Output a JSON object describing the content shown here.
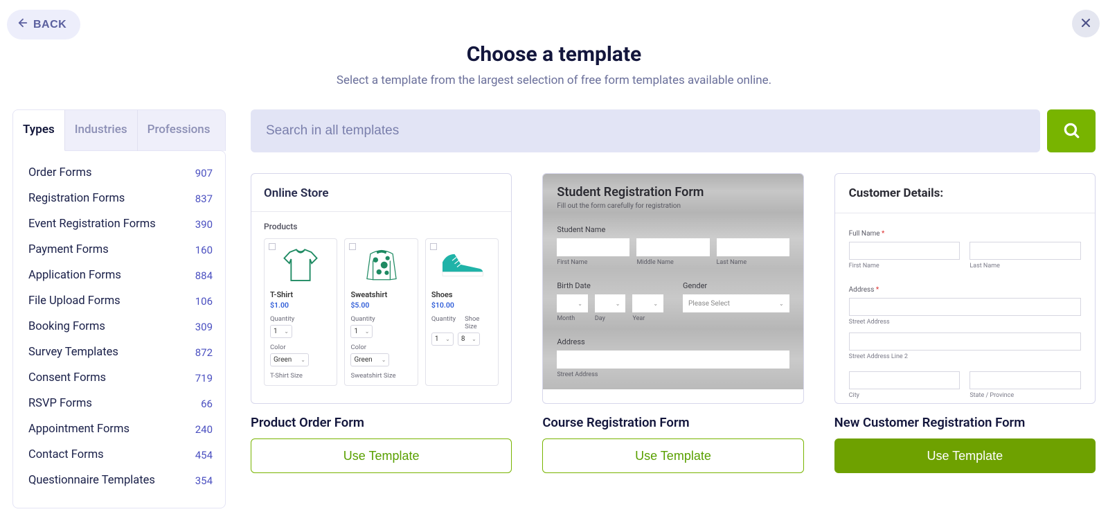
{
  "back_label": "BACK",
  "header": {
    "title": "Choose a template",
    "subtitle": "Select a template from the largest selection of free form templates available online."
  },
  "sidebar": {
    "tabs": [
      {
        "label": "Types",
        "active": true
      },
      {
        "label": "Industries",
        "active": false
      },
      {
        "label": "Professions",
        "active": false
      }
    ],
    "categories": [
      {
        "name": "Order Forms",
        "count": "907"
      },
      {
        "name": "Registration Forms",
        "count": "837"
      },
      {
        "name": "Event Registration Forms",
        "count": "390"
      },
      {
        "name": "Payment Forms",
        "count": "160"
      },
      {
        "name": "Application Forms",
        "count": "884"
      },
      {
        "name": "File Upload Forms",
        "count": "106"
      },
      {
        "name": "Booking Forms",
        "count": "309"
      },
      {
        "name": "Survey Templates",
        "count": "872"
      },
      {
        "name": "Consent Forms",
        "count": "719"
      },
      {
        "name": "RSVP Forms",
        "count": "66"
      },
      {
        "name": "Appointment Forms",
        "count": "240"
      },
      {
        "name": "Contact Forms",
        "count": "454"
      },
      {
        "name": "Questionnaire Templates",
        "count": "354"
      }
    ]
  },
  "search": {
    "placeholder": "Search in all templates"
  },
  "cards": [
    {
      "title": "Product Order Form",
      "button": "Use Template",
      "style": "outline",
      "preview": {
        "title": "Online Store",
        "label_products": "Products",
        "products": [
          {
            "name": "T-Shirt",
            "price": "$1.00",
            "qty_label": "Quantity",
            "qty": "1",
            "color_label": "Color",
            "color": "Green",
            "size_label": "T-Shirt Size"
          },
          {
            "name": "Sweatshirt",
            "price": "$5.00",
            "qty_label": "Quantity",
            "qty": "1",
            "color_label": "Color",
            "color": "Green",
            "size_label": "Sweatshirt Size"
          },
          {
            "name": "Shoes",
            "price": "$10.00",
            "qty_label": "Quantity",
            "qty": "1",
            "shoesize_label": "Shoe Size",
            "shoesize": "8"
          }
        ]
      }
    },
    {
      "title": "Course Registration Form",
      "button": "Use Template",
      "style": "outline",
      "preview": {
        "title": "Student Registration Form",
        "subtitle": "Fill out the form carefully for registration",
        "name_label": "Student Name",
        "name_caps": [
          "First Name",
          "Middle Name",
          "Last Name"
        ],
        "birth_label": "Birth Date",
        "birth_caps": [
          "Month",
          "Day",
          "Year"
        ],
        "gender_label": "Gender",
        "gender_placeholder": "Please Select",
        "address_label": "Address",
        "address_cap": "Street Address"
      }
    },
    {
      "title": "New Customer Registration Form",
      "button": "Use Template",
      "style": "solid",
      "preview": {
        "title": "Customer Details:",
        "fullname_label": "Full Name",
        "fullname_caps": [
          "First Name",
          "Last Name"
        ],
        "address_label": "Address",
        "address_caps": [
          "Street Address",
          "Street Address Line 2"
        ],
        "city_caps": [
          "City",
          "State / Province"
        ]
      }
    }
  ]
}
